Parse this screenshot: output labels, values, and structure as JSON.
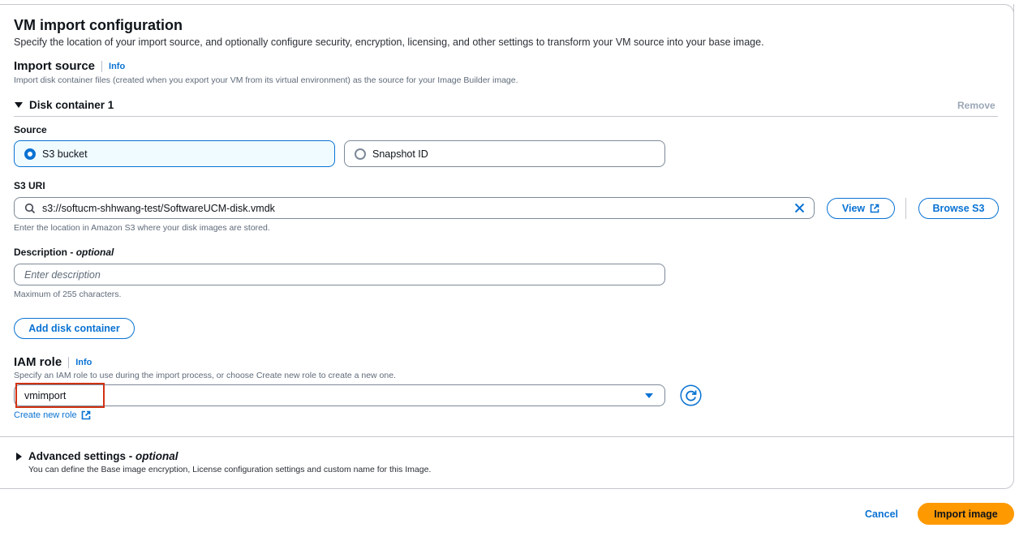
{
  "header": {
    "title": "VM import configuration",
    "description": "Specify the location of your import source, and optionally configure security, encryption, licensing, and other settings to transform your VM source into your base image."
  },
  "import_source": {
    "title": "Import source",
    "info": "Info",
    "description": "Import disk container files (created when you export your VM from its virtual environment) as the source for your Image Builder image."
  },
  "disk_container": {
    "title": "Disk container 1",
    "remove": "Remove",
    "source_label": "Source",
    "options": [
      "S3 bucket",
      "Snapshot ID"
    ],
    "selected_option": "S3 bucket",
    "s3_uri_label": "S3 URI",
    "s3_uri_value": "s3://softucm-shhwang-test/SoftwareUCM-disk.vmdk",
    "s3_uri_hint": "Enter the location in Amazon S3 where your disk images are stored.",
    "view_button": "View",
    "browse_button": "Browse S3",
    "description_label": "Description - ",
    "description_optional": "optional",
    "description_placeholder": "Enter description",
    "description_hint": "Maximum of 255 characters.",
    "add_button": "Add disk container"
  },
  "iam_role": {
    "title": "IAM role",
    "info": "Info",
    "description": "Specify an IAM role to use during the import process, or choose Create new role to create a new one.",
    "selected_value": "vmimport",
    "create_link": "Create new role"
  },
  "advanced": {
    "title": "Advanced settings - ",
    "optional": "optional",
    "description": "You can define the Base image encryption, License configuration settings and custom name for this Image."
  },
  "footer": {
    "cancel": "Cancel",
    "import": "Import image"
  },
  "colors": {
    "link": "#0972d3",
    "primary_button": "#ff9900",
    "highlight": "#d13212"
  }
}
